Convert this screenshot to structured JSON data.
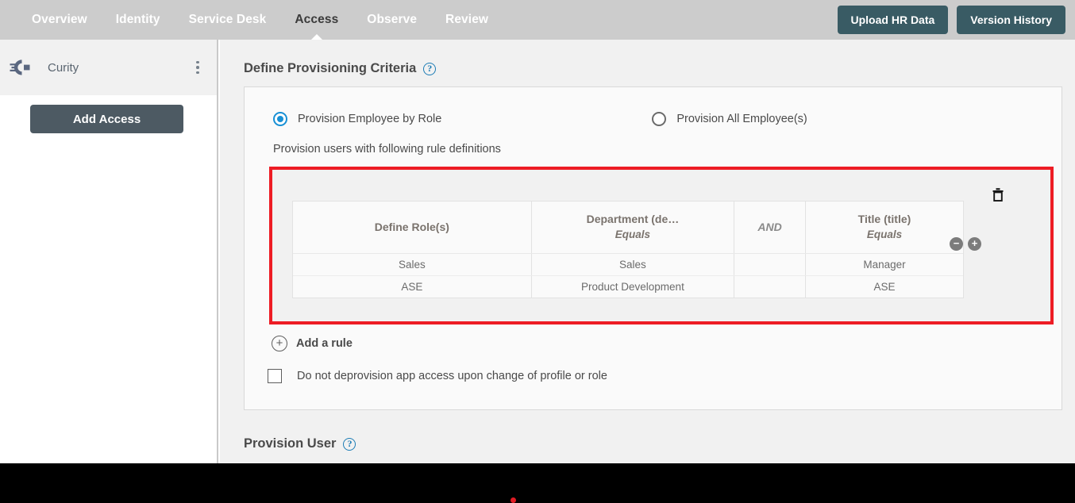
{
  "topnav": {
    "items": [
      {
        "label": "Overview",
        "active": false
      },
      {
        "label": "Identity",
        "active": false
      },
      {
        "label": "Service Desk",
        "active": false
      },
      {
        "label": "Access",
        "active": true
      },
      {
        "label": "Observe",
        "active": false
      },
      {
        "label": "Review",
        "active": false
      }
    ],
    "buttons": [
      {
        "label": "Upload HR Data"
      },
      {
        "label": "Version History"
      }
    ],
    "background_color": "#cccccc",
    "button_color": "#395b64"
  },
  "sidebar": {
    "app": {
      "name": "Curity",
      "logo_icon": "curity-logo-icon",
      "menu_icon": "kebab-menu-icon"
    },
    "add_access_label": "Add Access"
  },
  "main": {
    "section_title": "Define Provisioning Criteria",
    "help_icon_glyph": "?",
    "radios": [
      {
        "label": "Provision Employee by Role",
        "selected": true
      },
      {
        "label": "Provision All Employee(s)",
        "selected": false
      }
    ],
    "rule_caption": "Provision users with following rule definitions",
    "rule_table": {
      "columns": [
        {
          "name": "Define Role(s)",
          "operator": ""
        },
        {
          "name": "Department (de…",
          "operator": "Equals"
        },
        {
          "name": "AND",
          "operator": "",
          "is_conjunction": true
        },
        {
          "name": "Title (title)",
          "operator": "Equals"
        }
      ],
      "rows": [
        {
          "role": "Sales",
          "department": "Sales",
          "and": "",
          "title": "Manager"
        },
        {
          "role": "ASE",
          "department": "Product Development",
          "and": "",
          "title": "ASE"
        }
      ],
      "delete_icon": "trash-icon",
      "remove_row_glyph": "−",
      "add_row_glyph": "+"
    },
    "add_rule_label": "Add a rule",
    "add_rule_glyph": "+",
    "checkbox": {
      "label": "Do not deprovision app access upon change of profile or role",
      "checked": false
    },
    "provision_user_title": "Provision User",
    "highlight_color": "#ed1c24"
  }
}
